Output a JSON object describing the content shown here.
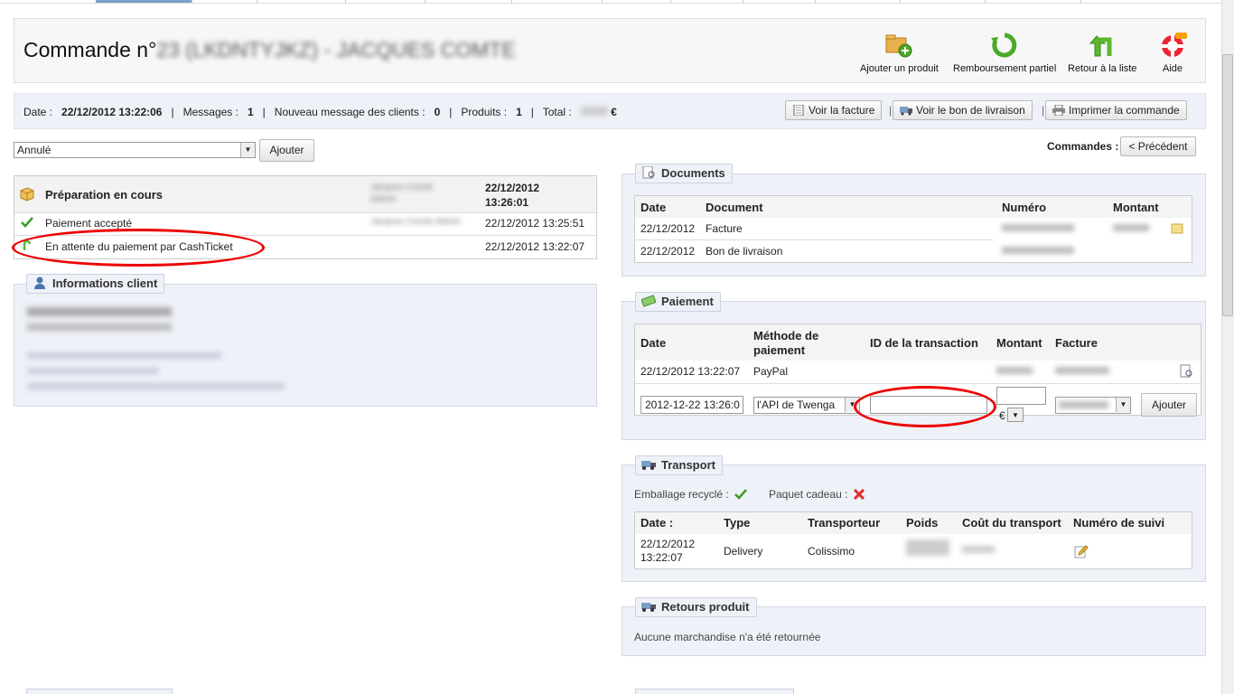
{
  "page": {
    "title_prefix": "Commande n°",
    "title_redacted": "23 (LKDNTYJKZ) - JACQUES COMTE"
  },
  "toolbar": {
    "add_product": "Ajouter un produit",
    "partial_refund": "Remboursement partiel",
    "back_to_list": "Retour à la liste",
    "help": "Aide"
  },
  "summary": {
    "date_label": "Date :",
    "date_value": "22/12/2012 13:22:06",
    "messages_label": "Messages :",
    "messages_value": "1",
    "new_messages_label": "Nouveau message des clients :",
    "new_messages_value": "0",
    "products_label": "Produits :",
    "products_value": "1",
    "total_label": "Total :",
    "total_currency": "€",
    "view_invoice": "Voir la facture",
    "view_delivery": "Voir le bon de livraison",
    "print_order": "Imprimer la commande"
  },
  "status": {
    "selected": "Annulé",
    "add_button": "Ajouter"
  },
  "orders_nav": {
    "label": "Commandes :",
    "previous": "< Précédent"
  },
  "history": {
    "current_state": "Préparation en cours",
    "current_date": "22/12/2012 13:26:01",
    "rows": [
      {
        "state": "Paiement accepté",
        "date": "22/12/2012 13:25:51"
      },
      {
        "state": "En attente du paiement par CashTicket",
        "date": "22/12/2012 13:22:07"
      }
    ]
  },
  "client": {
    "legend": "Informations client"
  },
  "documents": {
    "legend": "Documents",
    "headers": [
      "Date",
      "Document",
      "Numéro",
      "Montant"
    ],
    "rows": [
      {
        "date": "22/12/2012",
        "document": "Facture"
      },
      {
        "date": "22/12/2012",
        "document": "Bon de livraison"
      }
    ]
  },
  "payment": {
    "legend": "Paiement",
    "headers": [
      "Date",
      "Méthode de paiement",
      "ID de la transaction",
      "Montant",
      "Facture"
    ],
    "row": {
      "date": "22/12/2012 13:22:07",
      "method": "PayPal"
    },
    "form": {
      "date_value": "2012-12-22 13:26:0",
      "method_value": "l'API de Twenga",
      "currency": "€",
      "add_button": "Ajouter"
    }
  },
  "transport": {
    "legend": "Transport",
    "recycled_label": "Emballage recyclé :",
    "gift_label": "Paquet cadeau :",
    "headers": [
      "Date :",
      "Type",
      "Transporteur",
      "Poids",
      "Coût du transport",
      "Numéro de suivi"
    ],
    "row": {
      "date_line1": "22/12/2012",
      "date_line2": "13:22:07",
      "type": "Delivery",
      "carrier": "Colissimo"
    }
  },
  "returns": {
    "legend": "Retours produit",
    "empty_text": "Aucune marchandise n'a été retournée"
  }
}
